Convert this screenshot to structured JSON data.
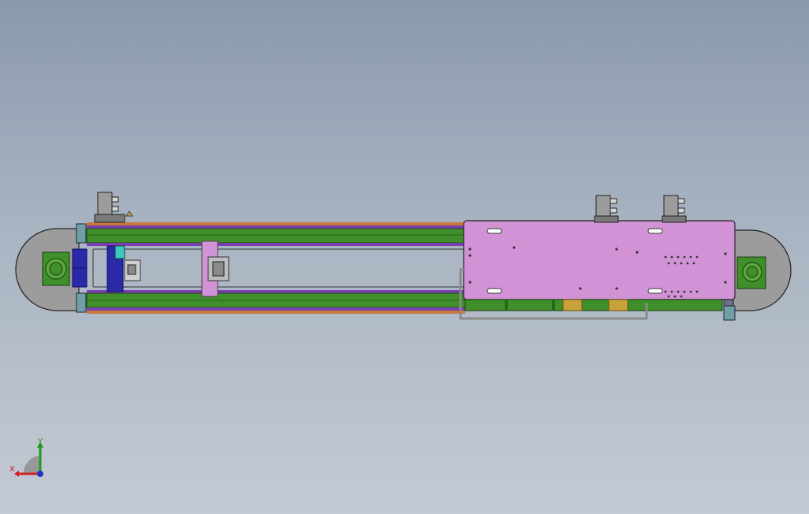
{
  "viewport": {
    "background_top": "#8a99ad",
    "background_bottom": "#c4cad4"
  },
  "colors": {
    "rail_green": "#3f8f2a",
    "rail_dark_green": "#2a6620",
    "purple_strip": "#7a3fb0",
    "orange_strip": "#c7783a",
    "carriage_pink": "#d293d6",
    "pulley_gray": "#9a9a9a",
    "motor_blue": "#2a2aa8",
    "cylinder_gold": "#c8a23a"
  },
  "triad": {
    "x_label": "X",
    "y_label": "Y",
    "x_color": "#d22020",
    "y_color": "#1f9a1f",
    "z_color": "#2030c8"
  }
}
